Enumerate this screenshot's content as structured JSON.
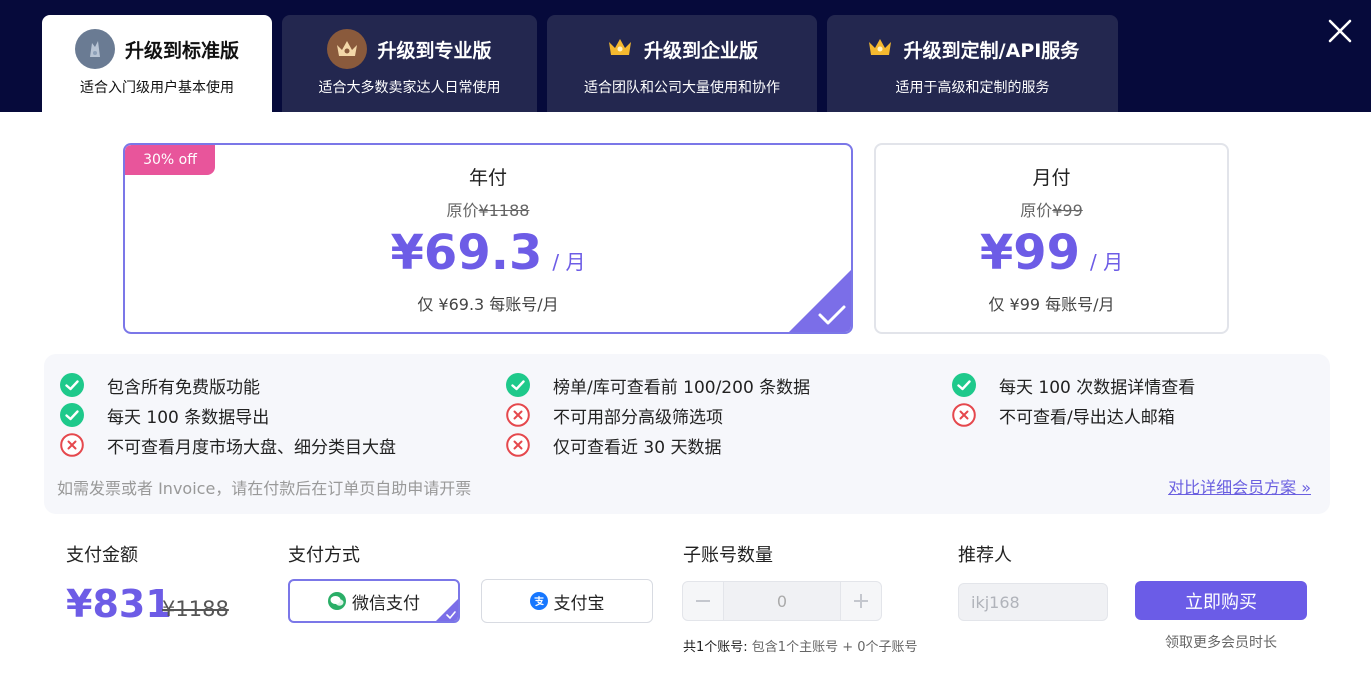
{
  "tabs": [
    {
      "title": "升级到标准版",
      "desc": "适合入门级用户基本使用",
      "icon": "standard-badge-icon"
    },
    {
      "title": "升级到专业版",
      "desc": "适合大多数卖家达人日常使用",
      "icon": "pro-crown-badge-icon"
    },
    {
      "title": "升级到企业版",
      "desc": "适合团队和公司大量使用和协作",
      "icon": "crown-icon"
    },
    {
      "title": "升级到定制/API服务",
      "desc": "适用于高级和定制的服务",
      "icon": "crown-icon"
    }
  ],
  "plans": {
    "annual": {
      "discount": "30% off",
      "label": "年付",
      "orig_prefix": "原价",
      "orig_price": "¥1188",
      "price": "¥69.3",
      "unit": "/ 月",
      "per_account": "仅 ¥69.3 每账号/月",
      "selected": true
    },
    "monthly": {
      "label": "月付",
      "orig_prefix": "原价",
      "orig_price": "¥99",
      "price": "¥99",
      "unit": "/ 月",
      "per_account": "仅 ¥99 每账号/月",
      "selected": false
    }
  },
  "features": {
    "items": [
      {
        "text": "包含所有免费版功能",
        "included": true
      },
      {
        "text": "榜单/库可查看前 100/200 条数据",
        "included": true
      },
      {
        "text": "每天 100 次数据详情查看",
        "included": true
      },
      {
        "text": "每天 100 条数据导出",
        "included": true
      },
      {
        "text": "不可用部分高级筛选项",
        "included": false
      },
      {
        "text": "不可查看/导出达人邮箱",
        "included": false
      },
      {
        "text": "不可查看月度市场大盘、细分类目大盘",
        "included": false
      },
      {
        "text": "仅可查看近 30 天数据",
        "included": false
      }
    ],
    "note": "如需发票或者 Invoice，请在付款后在订单页自助申请开票",
    "compare_link": "对比详细会员方案 »"
  },
  "payment": {
    "amount_label": "支付金额",
    "amount": "¥831",
    "amount_orig": "¥1188",
    "method_label": "支付方式",
    "methods": [
      {
        "label": "微信支付",
        "selected": true
      },
      {
        "label": "支付宝",
        "selected": false
      }
    ],
    "sub_label": "子账号数量",
    "sub_value": "0",
    "sub_note_total": "共1个账号:",
    "sub_note_detail": "包含1个主账号 + 0个子账号",
    "referrer_label": "推荐人",
    "referrer_value": "ikj168",
    "buy_label": "立即购买",
    "buy_note": "领取更多会员时长"
  },
  "colors": {
    "accent": "#6d5ce6",
    "topbar": "#060a3b",
    "tab_bg": "#23274f",
    "discount": "#e8559b",
    "check": "#1ec98b",
    "cross": "#e5484d"
  }
}
